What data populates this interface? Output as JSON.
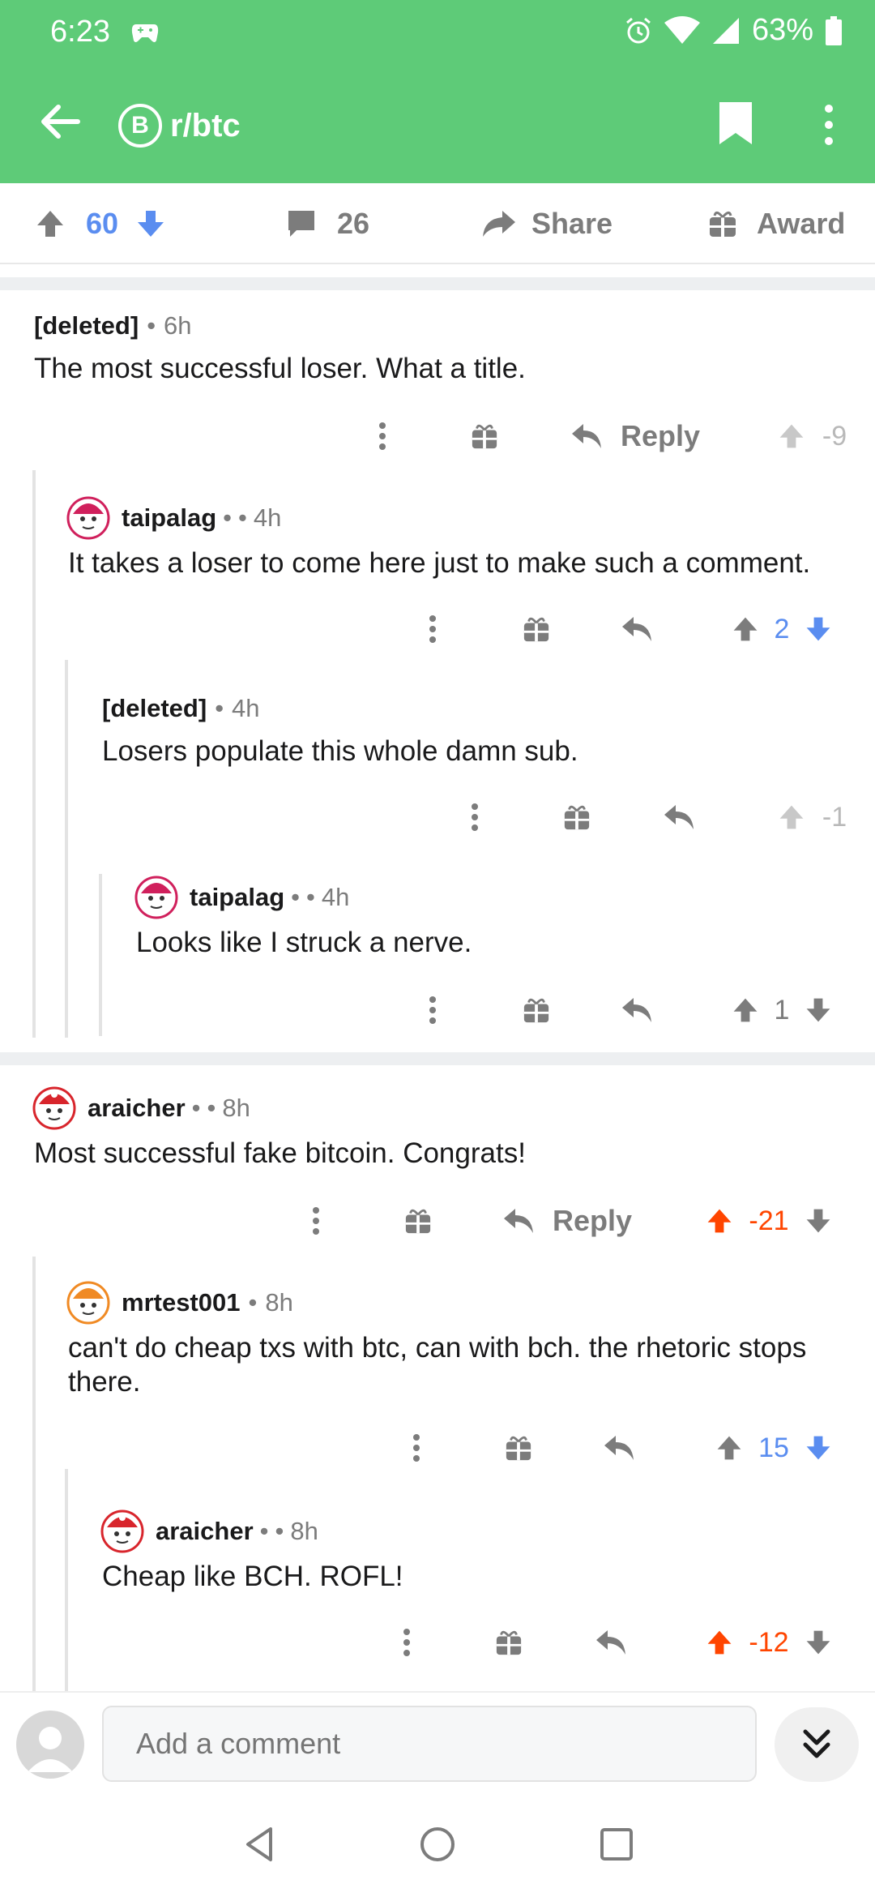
{
  "status": {
    "time": "6:23",
    "battery": "63%"
  },
  "toolbar": {
    "subreddit": "r/btc",
    "coin_symbol": "B"
  },
  "post_actions": {
    "score": "60",
    "comments": "26",
    "share_label": "Share",
    "award_label": "Award"
  },
  "comments": [
    {
      "user": "[deleted]",
      "flair": "",
      "time": "6h",
      "body": "The most successful loser. What a title.",
      "reply_label": "Reply",
      "score": "-9",
      "vote": "none"
    },
    {
      "user": "taipalag",
      "flair": "•",
      "time": "4h",
      "body": "It takes a loser to come here just to make such a comment.",
      "reply_label": "",
      "score": "2",
      "vote": "down"
    },
    {
      "user": "[deleted]",
      "flair": "",
      "time": "4h",
      "body": "Losers populate this whole damn sub.",
      "reply_label": "",
      "score": "-1",
      "vote": "none"
    },
    {
      "user": "taipalag",
      "flair": "•",
      "time": "4h",
      "body": "Looks like I struck a nerve.",
      "reply_label": "",
      "score": "1",
      "vote": "none"
    },
    {
      "user": "araicher",
      "flair": "•",
      "time": "8h",
      "body": "Most successful fake bitcoin. Congrats!",
      "reply_label": "Reply",
      "score": "-21",
      "vote": "up"
    },
    {
      "user": "mrtest001",
      "flair": "",
      "time": "8h",
      "body": "can't do cheap txs with btc, can with bch.  the rhetoric stops there.",
      "reply_label": "",
      "score": "15",
      "vote": "down"
    },
    {
      "user": "araicher",
      "flair": "•",
      "time": "8h",
      "body": "Cheap like BCH. ROFL!",
      "reply_label": "",
      "score": "-12",
      "vote": "up"
    }
  ],
  "composer": {
    "placeholder": "Add a comment"
  },
  "colors": {
    "header": "#5ecb78",
    "upvote": "#ff4500",
    "downvote": "#5a8df0",
    "muted": "#7c7c7c"
  }
}
